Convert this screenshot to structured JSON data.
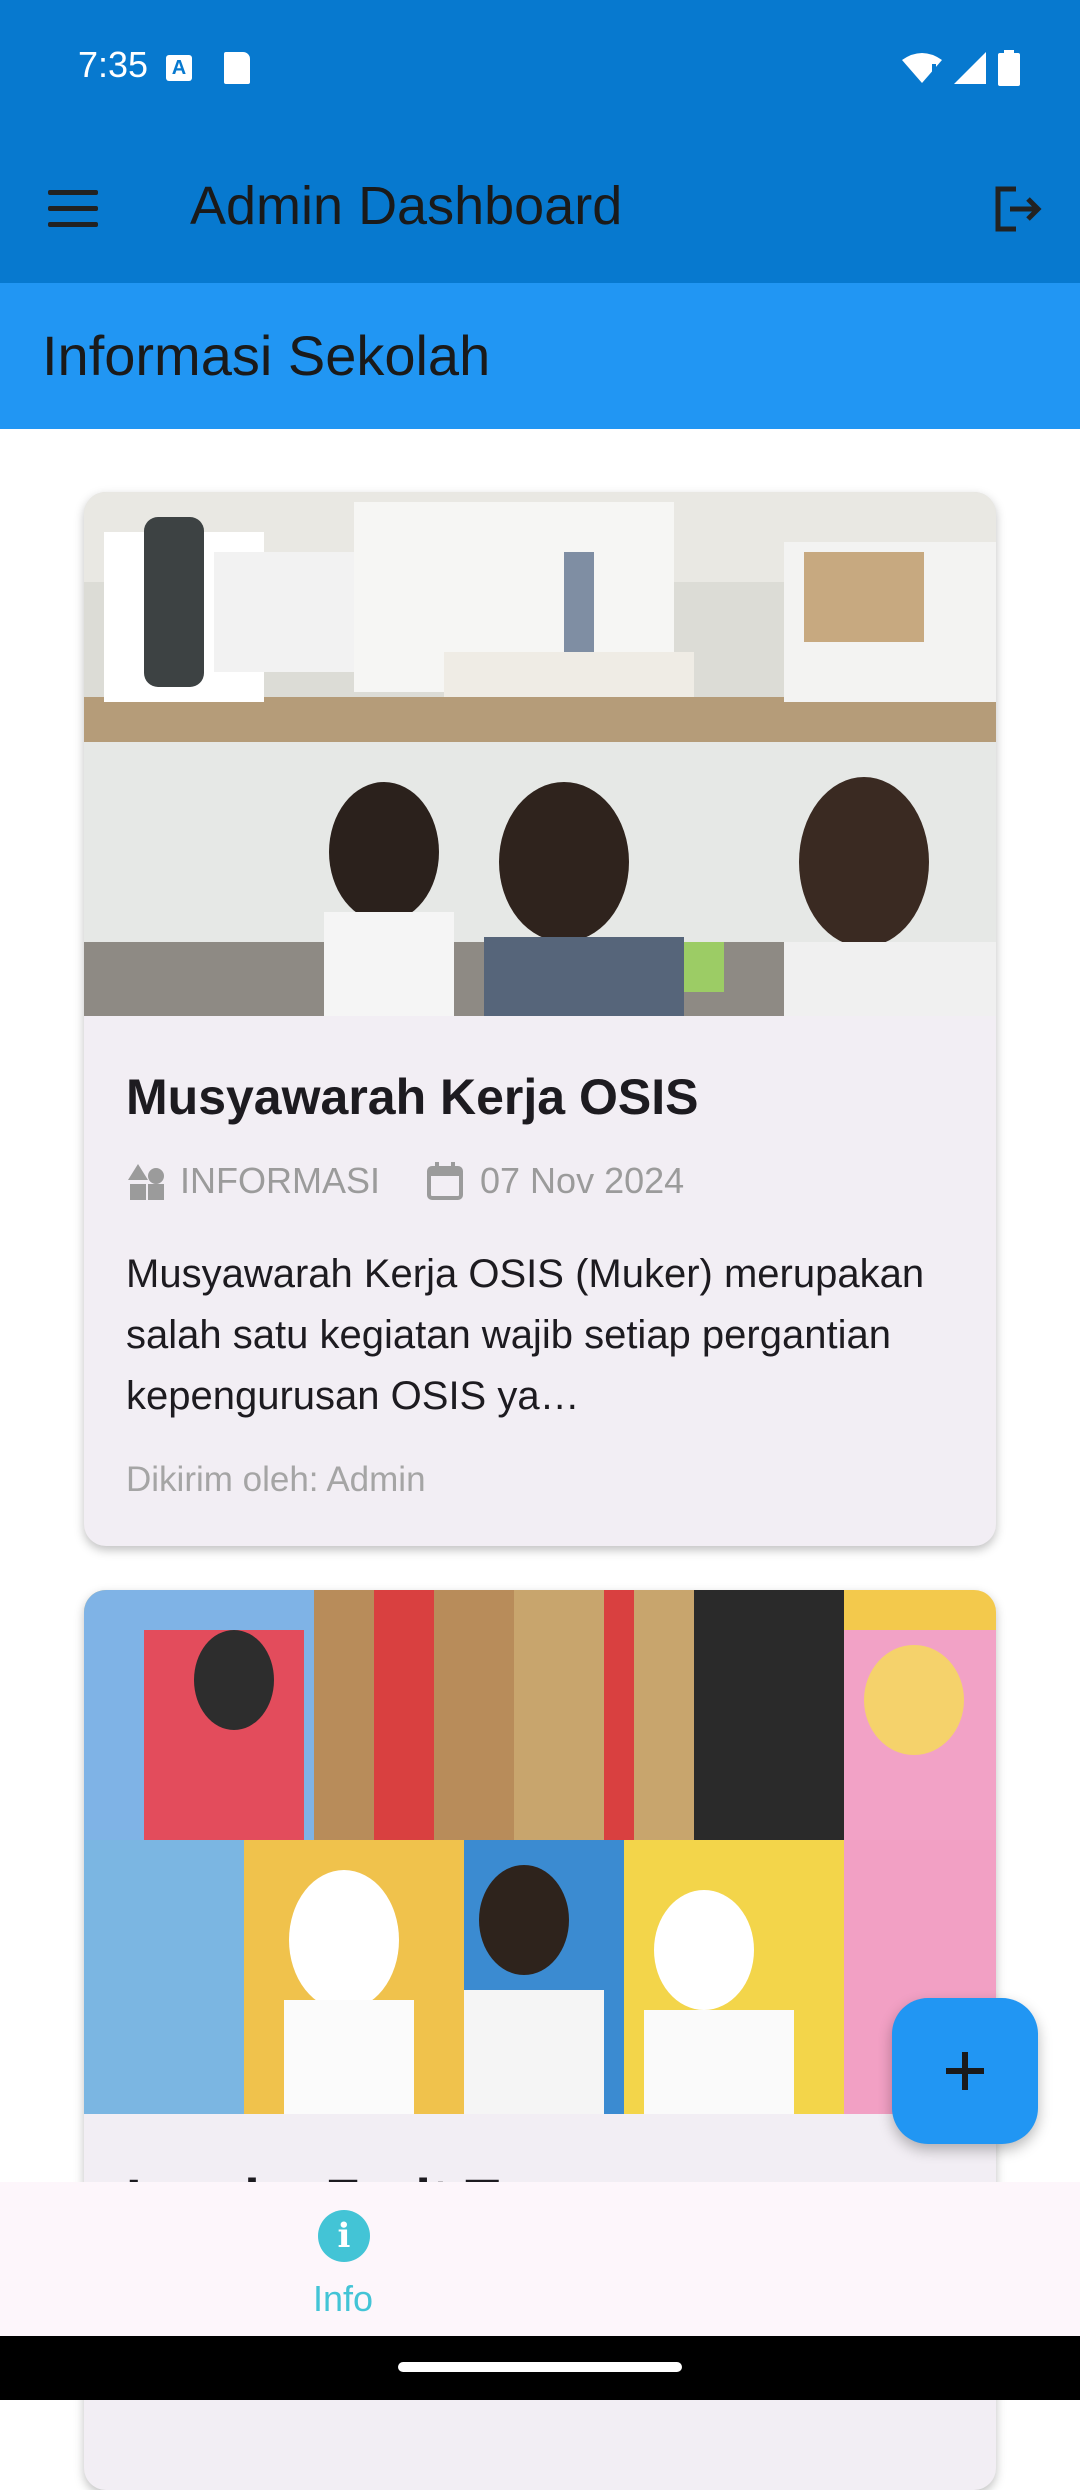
{
  "status_bar": {
    "time": "7:35",
    "left_icons": [
      "text-input-icon",
      "sd-card-icon"
    ],
    "right_icons": [
      "wifi-icon",
      "signal-icon",
      "battery-icon"
    ]
  },
  "app_bar": {
    "title": "Admin Dashboard",
    "menu_icon": "menu-icon",
    "logout_icon": "logout-icon",
    "color": "#0779CF"
  },
  "section": {
    "title": "Informasi Sekolah",
    "color": "#2196F3"
  },
  "posts": [
    {
      "title": "Musyawarah Kerja OSIS",
      "category": "INFORMASI",
      "date": "07 Nov 2024",
      "excerpt": "Musyawarah Kerja OSIS (Muker) merupakan salah satu kegiatan wajib setiap pergantian kepengurusan OSIS ya…",
      "sender": "Dikirim oleh: Admin"
    },
    {
      "title": "Lomba Fruit Tea"
    }
  ],
  "fab": {
    "icon": "plus-icon"
  },
  "bottom_nav": {
    "items": [
      {
        "label": "Info",
        "icon": "info-icon"
      }
    ],
    "accent": "#43C4D6"
  }
}
